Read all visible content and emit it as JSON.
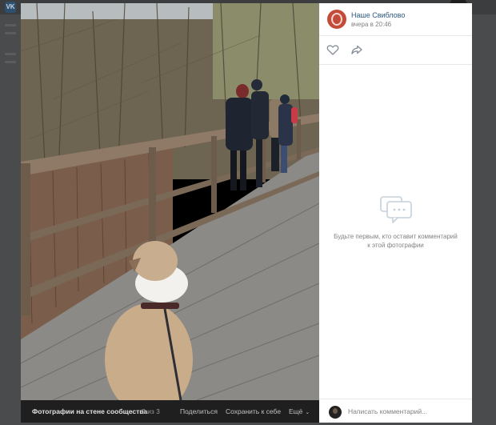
{
  "colors": {
    "overlay": "#4a4b4c",
    "viewer_bg": "#000000",
    "link": "#2a5885",
    "muted": "#828282",
    "bottom_bar": "#1f1f1f"
  },
  "background": {
    "logo_text": "VK"
  },
  "photo": {
    "description_icon": "photo-of-dog-on-wooden-bridge"
  },
  "photo_bar": {
    "album_title": "Фотографии на стене сообщества",
    "counter": "3 из 3",
    "share_label": "Поделиться",
    "save_label": "Сохранить к себе",
    "more_label": "Ещё"
  },
  "post": {
    "author": "Наше Свиблово",
    "time": "вчера в 20:46"
  },
  "actions": {
    "like_icon": "heart-icon",
    "share_icon": "share-arrow-icon"
  },
  "comments": {
    "empty_icon": "comment-bubbles-icon",
    "empty_text": "Будьте первым, кто оставит комментарий к этой фотографии",
    "input_placeholder": "Написать комментарий..."
  }
}
